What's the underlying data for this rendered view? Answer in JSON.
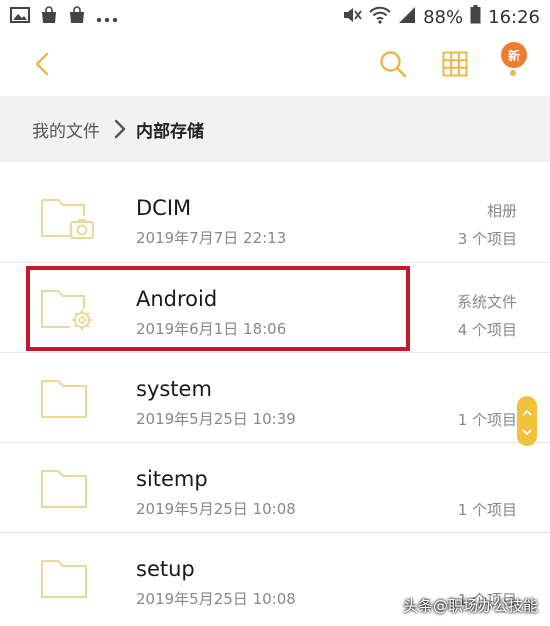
{
  "status_bar": {
    "battery": "88%",
    "time": "16:26",
    "icons": [
      "image-icon",
      "bag-icon",
      "bag-icon",
      "more-dots-icon",
      "mute-icon",
      "wifi-icon",
      "signal-icon",
      "battery-icon"
    ]
  },
  "toolbar": {
    "new_badge": "新"
  },
  "breadcrumb": {
    "root": "我的文件",
    "current": "内部存储"
  },
  "files": [
    {
      "name": "DCIM",
      "date": "2019年7月7日 22:13",
      "type": "相册",
      "count": "3 个项目",
      "folder_icon": "camera"
    },
    {
      "name": "Android",
      "date": "2019年6月1日 18:06",
      "type": "系统文件",
      "count": "4 个项目",
      "folder_icon": "gear"
    },
    {
      "name": "system",
      "date": "2019年5月25日 10:39",
      "type": "",
      "count": "1 个项目",
      "folder_icon": "plain"
    },
    {
      "name": "sitemp",
      "date": "2019年5月25日 10:08",
      "type": "",
      "count": "1 个项目",
      "folder_icon": "plain"
    },
    {
      "name": "setup",
      "date": "2019年5月25日 10:08",
      "type": "",
      "count": "1 个项目",
      "folder_icon": "plain"
    }
  ],
  "watermark": "头条@职场办公技能",
  "colors": {
    "accent": "#e9b84a",
    "folder": "#e8d89a",
    "badge": "#f07c2c",
    "highlight": "#c21a2a",
    "breadcrumb_bg": "#f2f2f2"
  }
}
